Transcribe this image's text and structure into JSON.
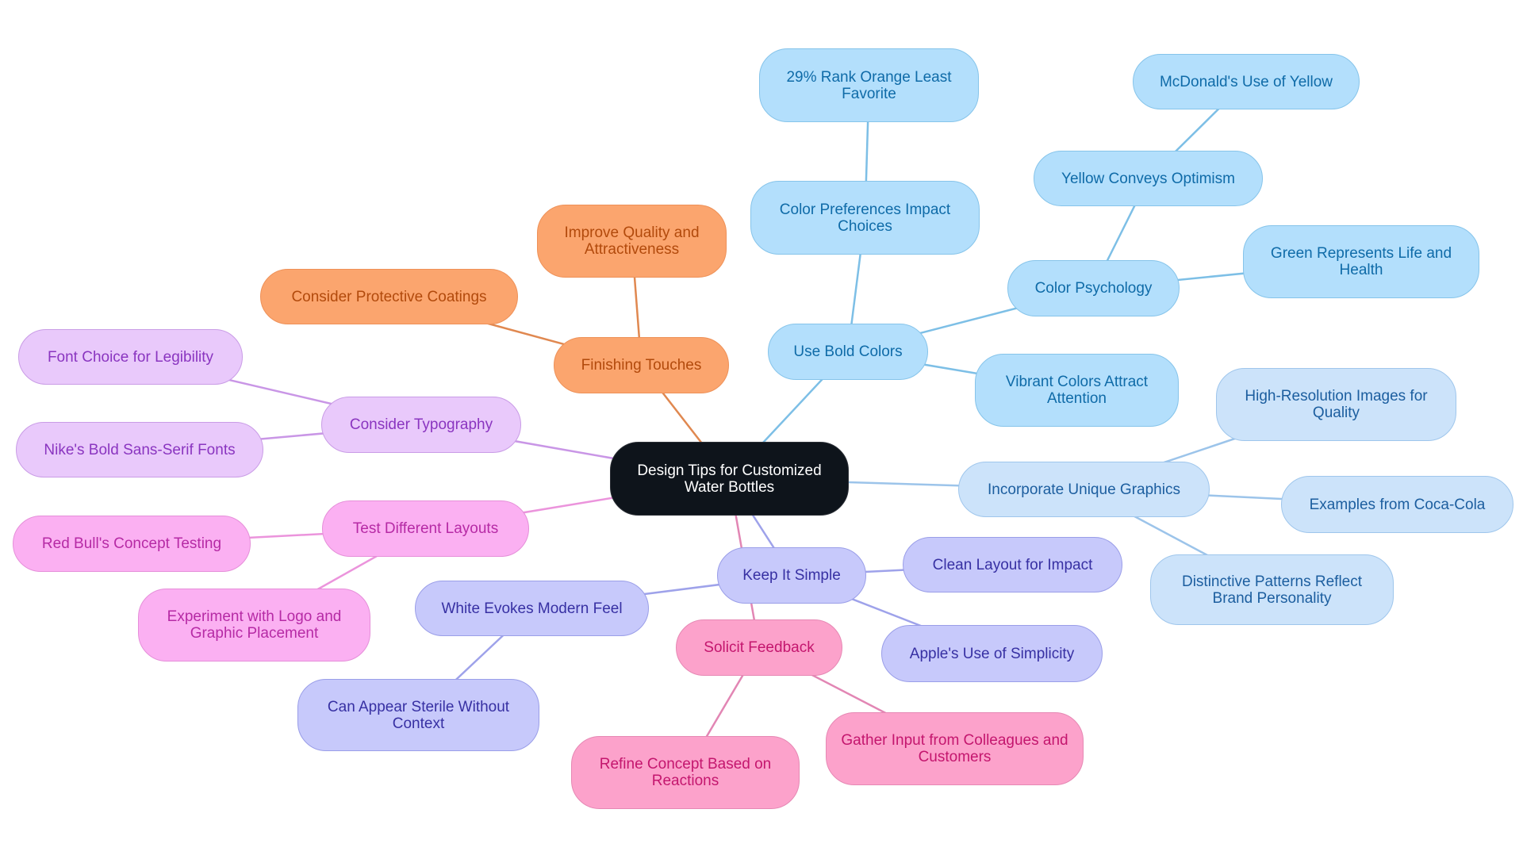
{
  "diagram": {
    "type": "mindmap",
    "root": {
      "id": "root",
      "label": "Design Tips for Customized Water Bottles"
    },
    "colors": {
      "root": "#0e141b",
      "finishing": "#fba56e",
      "typography": "#e9c9fb",
      "layouts": "#fbb0f2",
      "simple": "#c7c9fb",
      "feedback": "#fca2cb",
      "colors": "#b3dffc",
      "graphics": "#cce3fa"
    },
    "edge_colors": {
      "finishing": "#e08850",
      "typography": "#c996e6",
      "layouts": "#eb94dc",
      "simple": "#9ea2ea",
      "feedback": "#e286b4",
      "colors": "#7dbfe6",
      "graphics": "#9cc4ea"
    },
    "nodes": [
      {
        "id": "finishing",
        "label": "Finishing Touches",
        "parent": "root"
      },
      {
        "id": "improve",
        "label": "Improve Quality and Attractiveness",
        "parent": "finishing"
      },
      {
        "id": "coatings",
        "label": "Consider Protective Coatings",
        "parent": "finishing"
      },
      {
        "id": "typography",
        "label": "Consider Typography",
        "parent": "root"
      },
      {
        "id": "fontchoice",
        "label": "Font Choice for Legibility",
        "parent": "typography"
      },
      {
        "id": "nike",
        "label": "Nike's Bold Sans-Serif Fonts",
        "parent": "typography"
      },
      {
        "id": "layouts",
        "label": "Test Different Layouts",
        "parent": "root"
      },
      {
        "id": "redbull",
        "label": "Red Bull's Concept Testing",
        "parent": "layouts"
      },
      {
        "id": "experiment",
        "label": "Experiment with Logo and Graphic Placement",
        "parent": "layouts"
      },
      {
        "id": "simple",
        "label": "Keep It Simple",
        "parent": "root"
      },
      {
        "id": "white",
        "label": "White Evokes Modern Feel",
        "parent": "simple"
      },
      {
        "id": "sterile",
        "label": "Can Appear Sterile Without Context",
        "parent": "white"
      },
      {
        "id": "clean",
        "label": "Clean Layout for Impact",
        "parent": "simple"
      },
      {
        "id": "apple",
        "label": "Apple's Use of Simplicity",
        "parent": "simple"
      },
      {
        "id": "feedback",
        "label": "Solicit Feedback",
        "parent": "root"
      },
      {
        "id": "refine",
        "label": "Refine Concept Based on Reactions",
        "parent": "feedback"
      },
      {
        "id": "gather",
        "label": "Gather Input from Colleagues and Customers",
        "parent": "feedback"
      },
      {
        "id": "colors",
        "label": "Use Bold Colors",
        "parent": "root"
      },
      {
        "id": "prefs",
        "label": "Color Preferences Impact Choices",
        "parent": "colors"
      },
      {
        "id": "orange",
        "label": "29% Rank Orange Least Favorite",
        "parent": "prefs"
      },
      {
        "id": "psych",
        "label": "Color Psychology",
        "parent": "colors"
      },
      {
        "id": "yellow",
        "label": "Yellow Conveys Optimism",
        "parent": "psych"
      },
      {
        "id": "mcd",
        "label": "McDonald's Use of Yellow",
        "parent": "yellow"
      },
      {
        "id": "green",
        "label": "Green Represents Life and Health",
        "parent": "psych"
      },
      {
        "id": "vibrant",
        "label": "Vibrant Colors Attract Attention",
        "parent": "colors"
      },
      {
        "id": "graphics",
        "label": "Incorporate Unique Graphics",
        "parent": "root"
      },
      {
        "id": "hires",
        "label": "High-Resolution Images for Quality",
        "parent": "graphics"
      },
      {
        "id": "coke",
        "label": "Examples from Coca-Cola",
        "parent": "graphics"
      },
      {
        "id": "patterns",
        "label": "Distinctive Patterns Reflect Brand Personality",
        "parent": "graphics"
      }
    ]
  }
}
